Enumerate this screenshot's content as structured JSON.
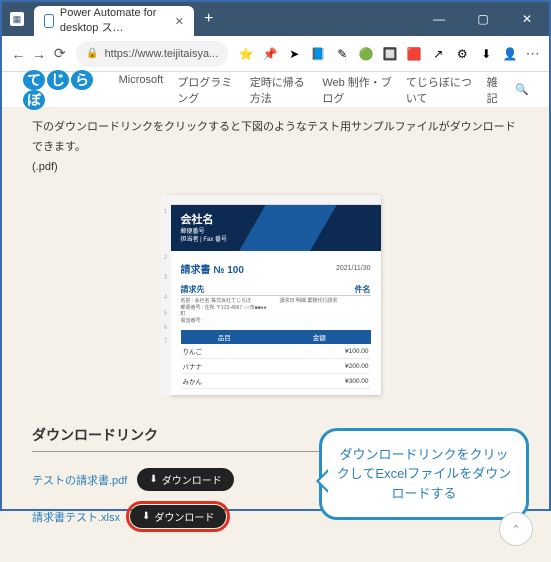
{
  "window": {
    "tab_title": "Power Automate for desktop ス…",
    "url": "https://www.teijitaisya..."
  },
  "ext_icons": [
    "⭐",
    "📌",
    "➤",
    "📘",
    "✎",
    "🟢",
    "🔲",
    "🟥",
    "↗",
    "⚙",
    "⬇",
    "👤"
  ],
  "site": {
    "logo_chars": [
      "て",
      "じ",
      "ら",
      "ぼ"
    ],
    "nav": [
      "Microsoft",
      "プログラミング",
      "定時に帰る方法",
      "Web 制作・ブログ",
      "てじらぼについて",
      "雑記"
    ]
  },
  "intro": {
    "line1": "下のダウンロードリンクをクリックすると下図のようなテスト用サンプルファイルがダウンロードできます。",
    "line2": "(.pdf)"
  },
  "doc": {
    "company": "会社名",
    "company_sub1": "郵便番号",
    "company_sub2": "担当者 | Fax 番号",
    "invoice_title": "請求書 № 100",
    "invoice_date": "2021/11/30",
    "billto_label": "請求先",
    "item_label": "件名",
    "billto_lines": [
      "名前 : 会社名 株式会社てじらぼ",
      "郵便番号 : 住所 〒123-4567 ○○市■■●●町",
      "電話番号 :"
    ],
    "item_lines": [
      "請求日 明細 業務代行請求"
    ],
    "table": {
      "headers": [
        "品目",
        "金額"
      ],
      "rows": [
        [
          "りんご",
          "¥100.00"
        ],
        [
          "バナナ",
          "¥200.00"
        ],
        [
          "みかん",
          "¥300.00"
        ]
      ]
    }
  },
  "downloads": {
    "section_title": "ダウンロードリンク",
    "items": [
      {
        "label": "テストの請求書.pdf",
        "btn": "ダウンロード"
      },
      {
        "label": "請求書テスト.xlsx",
        "btn": "ダウンロード"
      }
    ]
  },
  "callout": "ダウンロードリンクをクリックしてExcelファイルをダウンロードする"
}
